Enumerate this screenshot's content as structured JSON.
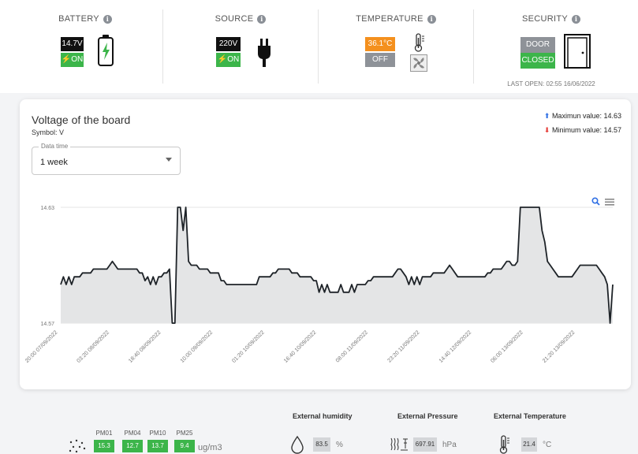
{
  "status": {
    "battery": {
      "title": "BATTERY",
      "voltage": "14.7V",
      "state": "ON"
    },
    "source": {
      "title": "SOURCE",
      "voltage": "220V",
      "state": "ON"
    },
    "temperature": {
      "title": "TEMPERATURE",
      "value": "36.1°C",
      "fan_state": "OFF"
    },
    "security": {
      "title": "SECURITY",
      "label": "DOOR",
      "state": "CLOSED",
      "last_open": "LAST OPEN: 02:55 16/06/2022"
    }
  },
  "chart_card": {
    "title": "Voltage of the board",
    "symbol": "Symbol: V",
    "max_label": "Maximun value: 14.63",
    "min_label": "Minimum value: 14.57",
    "select_label": "Data time",
    "select_value": "1 week"
  },
  "chart_data": {
    "type": "area",
    "title": "Voltage of the board",
    "y_ticks": [
      "14.63",
      "14.57"
    ],
    "ylim": [
      14.57,
      14.63
    ],
    "x_tick_labels": [
      "20:00 07/09/2022",
      "03:20 08/09/2022",
      "18:40 08/09/2022",
      "10:00 09/09/2022",
      "01:20 10/09/2022",
      "16:40 10/09/2022",
      "08:00 11/09/2022",
      "23:20 11/09/2022",
      "14:40 12/09/2022",
      "06:00 13/09/2022",
      "21:20 13/09/2022"
    ],
    "series": [
      {
        "values": [
          14.59,
          14.594,
          14.59,
          14.594,
          14.59,
          14.594,
          14.594,
          14.594,
          14.596,
          14.596,
          14.596,
          14.596,
          14.598,
          14.598,
          14.598,
          14.598,
          14.598,
          14.598,
          14.6,
          14.602,
          14.6,
          14.598,
          14.598,
          14.598,
          14.598,
          14.598,
          14.598,
          14.598,
          14.598,
          14.596,
          14.596,
          14.592,
          14.594,
          14.59,
          14.594,
          14.59,
          14.594,
          14.594,
          14.596,
          14.596,
          14.598,
          14.57,
          14.57,
          14.63,
          14.63,
          14.618,
          14.63,
          14.602,
          14.6,
          14.6,
          14.6,
          14.598,
          14.598,
          14.598,
          14.598,
          14.596,
          14.596,
          14.596,
          14.596,
          14.592,
          14.592,
          14.59,
          14.59,
          14.59,
          14.59,
          14.59,
          14.59,
          14.59,
          14.59,
          14.59,
          14.59,
          14.59,
          14.59,
          14.594,
          14.594,
          14.594,
          14.594,
          14.594,
          14.596,
          14.596,
          14.598,
          14.598,
          14.598,
          14.598,
          14.598,
          14.596,
          14.596,
          14.596,
          14.594,
          14.594,
          14.594,
          14.594,
          14.594,
          14.592,
          14.592,
          14.586,
          14.59,
          14.586,
          14.59,
          14.586,
          14.586,
          14.586,
          14.586,
          14.59,
          14.586,
          14.586,
          14.586,
          14.59,
          14.586,
          14.59,
          14.59,
          14.59,
          14.59,
          14.592,
          14.592,
          14.594,
          14.594,
          14.594,
          14.594,
          14.594,
          14.594,
          14.594,
          14.594,
          14.596,
          14.598,
          14.598,
          14.596,
          14.594,
          14.59,
          14.594,
          14.59,
          14.594,
          14.59,
          14.594,
          14.594,
          14.594,
          14.594,
          14.596,
          14.596,
          14.596,
          14.596,
          14.596,
          14.598,
          14.6,
          14.598,
          14.596,
          14.594,
          14.594,
          14.594,
          14.594,
          14.594,
          14.594,
          14.594,
          14.594,
          14.594,
          14.594,
          14.594,
          14.596,
          14.596,
          14.598,
          14.598,
          14.598,
          14.598,
          14.6,
          14.602,
          14.602,
          14.6,
          14.6,
          14.602,
          14.63,
          14.63,
          14.63,
          14.63,
          14.63,
          14.63,
          14.63,
          14.63,
          14.618,
          14.612,
          14.602,
          14.6,
          14.598,
          14.596,
          14.594,
          14.594,
          14.594,
          14.594,
          14.594,
          14.594,
          14.596,
          14.598,
          14.6,
          14.6,
          14.6,
          14.6,
          14.6,
          14.6,
          14.6,
          14.598,
          14.596,
          14.594,
          14.59,
          14.57,
          14.59
        ]
      }
    ],
    "fill_color": "#e4e5e6",
    "line_color": "#1e2328"
  },
  "sensors": {
    "pm_labels": [
      "PM01",
      "PM04",
      "PM10",
      "PM25"
    ],
    "pm_values": [
      "15.3",
      "12.7",
      "13.7",
      "9.4"
    ],
    "pm_unit": "ug/m3",
    "humidity": {
      "title": "External humidity",
      "value": "83.5",
      "unit": "%"
    },
    "pressure": {
      "title": "External Pressure",
      "value": "697.91",
      "unit": "hPa"
    },
    "temperature": {
      "title": "External Temperature",
      "value": "21.4",
      "unit": "°C"
    }
  },
  "colors": {
    "accent_green": "#3cb54a",
    "accent_orange": "#f4901e",
    "max_arrow": "#2f6fe4",
    "min_arrow": "#e53935"
  },
  "icons": [
    "info-icon",
    "battery-charging-icon",
    "power-plug-icon",
    "thermometer-icon",
    "fan-icon",
    "door-icon",
    "max-arrow-icon",
    "min-arrow-icon",
    "zoom-icon",
    "menu-icon",
    "dust-particles-icon",
    "water-drop-icon",
    "pressure-icon",
    "thermometer-small-icon",
    "bolt-icon"
  ]
}
